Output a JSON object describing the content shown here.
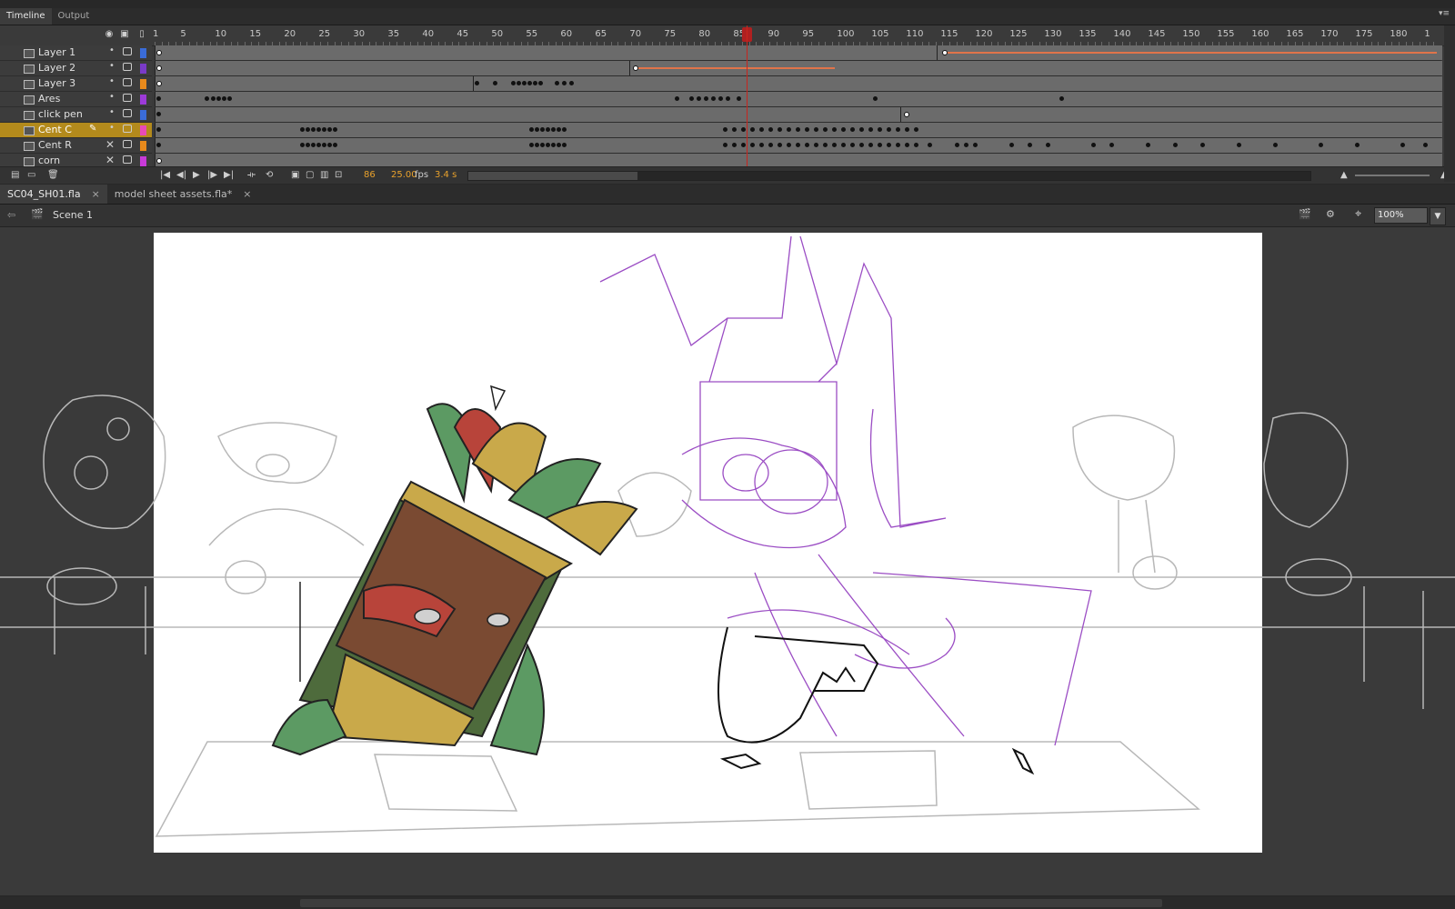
{
  "panel_tabs": [
    "Timeline",
    "Output"
  ],
  "ruler_labels": [
    "1",
    "5",
    "10",
    "15",
    "20",
    "25",
    "30",
    "35",
    "40",
    "45",
    "50",
    "55",
    "60",
    "65",
    "70",
    "75",
    "80",
    "85",
    "90",
    "95",
    "100",
    "105",
    "110",
    "115",
    "120",
    "125",
    "130",
    "135",
    "140",
    "145",
    "150",
    "155",
    "160",
    "165",
    "170",
    "175",
    "180",
    "1"
  ],
  "layers": [
    {
      "name": "Layer 1",
      "color": "#3a6cd8",
      "hidden": false,
      "selected": false
    },
    {
      "name": "Layer 2",
      "color": "#7a3ac8",
      "hidden": false,
      "selected": false
    },
    {
      "name": "Layer 3",
      "color": "#e88a1c",
      "hidden": false,
      "selected": false
    },
    {
      "name": "Ares",
      "color": "#9c3ad8",
      "hidden": false,
      "selected": false
    },
    {
      "name": "click pen",
      "color": "#3a6cd8",
      "hidden": false,
      "selected": false
    },
    {
      "name": "Cent C",
      "color": "#e84ab8",
      "hidden": false,
      "selected": true
    },
    {
      "name": "Cent R",
      "color": "#e88a1c",
      "hidden": true,
      "selected": false
    },
    {
      "name": "corn",
      "color": "#c83ad8",
      "hidden": true,
      "selected": false
    }
  ],
  "playback": {
    "current_frame": "86",
    "fps": "25.00",
    "fps_unit": "fps",
    "elapsed": "3.4 s"
  },
  "doc_tabs": [
    {
      "label": "SC04_SH01.fla",
      "active": true
    },
    {
      "label": "model sheet assets.fla*",
      "active": false
    }
  ],
  "edit_bar": {
    "scene": "Scene 1",
    "zoom": "100%"
  },
  "icons": {
    "eye": "eye-icon",
    "lock": "lock-icon",
    "outline": "outline-icon",
    "close": "close-icon"
  }
}
